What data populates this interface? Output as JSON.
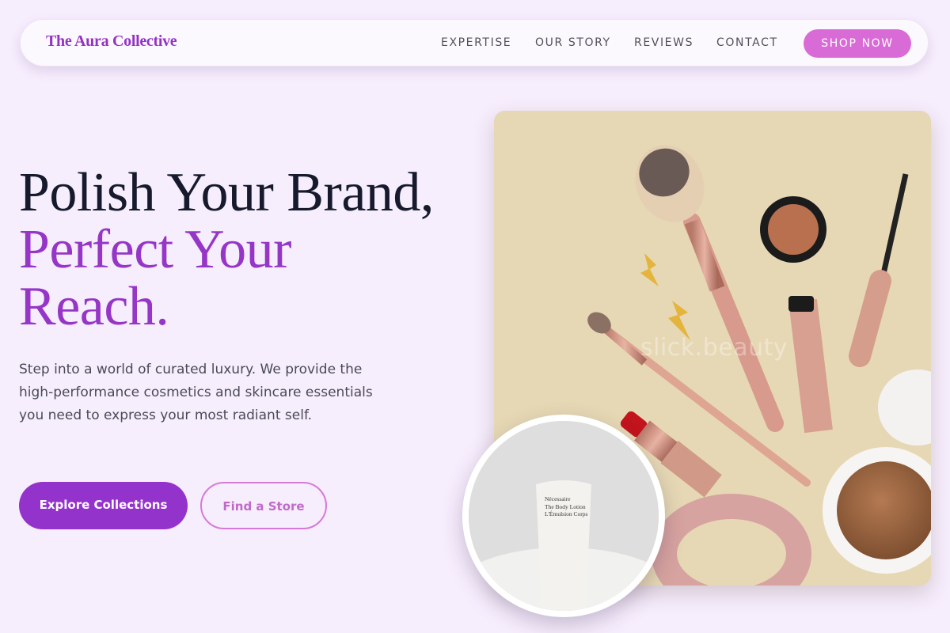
{
  "header": {
    "brand": "The Aura Collective",
    "nav": [
      "EXPERTISE",
      "OUR STORY",
      "REVIEWS",
      "CONTACT"
    ],
    "cta": "SHOP NOW"
  },
  "hero": {
    "title_line1": "Polish Your Brand,",
    "title_line2": "Perfect Your",
    "title_line3": "Reach.",
    "description": "Step into a world of curated luxury. We provide the high-performance cosmetics and skincare essentials you need to express your most radiant self.",
    "primary_button": "Explore Collections",
    "secondary_button": "Find a Store"
  },
  "images": {
    "main_watermark": "slick.beauty",
    "product_brand": "Nécessaire",
    "product_line1": "The Body Lotion",
    "product_line2": "L'Émulsion Corps"
  },
  "colors": {
    "background": "#f6edfd",
    "accent_purple": "#9433cc",
    "accent_pink": "#d96bd6",
    "heading_dark": "#161a2c"
  }
}
